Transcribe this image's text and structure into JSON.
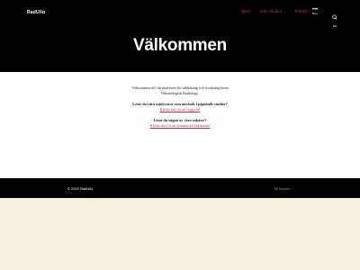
{
  "header": {
    "logo_text": "RadUllo",
    "nav": {
      "items": [
        {
          "label": "Hjem"
        },
        {
          "label": "Arkiv studier"
        },
        {
          "label": "Enkäter"
        }
      ]
    },
    "menu_toggle": {
      "icon": "dots-icon",
      "label": "Meny"
    },
    "search_toggle": {
      "icon": "search-icon",
      "label": "Sök"
    }
  },
  "hero": {
    "title": "Välkommen"
  },
  "main": {
    "intro": "Välkommen till vår plattform för utbildning och forskning inom Odontologisk Radiologi.",
    "question1": "Letar du våra mjukvaror som används i pågående studier?",
    "link1": "Klicka här för att logga in!",
    "question2": "Letar du någon av våra enkäter?",
    "link2": "Klicka här för att komma till enkäterna!"
  },
  "footer": {
    "copyright": "© 2022 RadUllo",
    "to_top": "Till toppen ↑"
  },
  "colors": {
    "accent": "#cd2653",
    "header_bg": "#000000",
    "page_bg": "#f5efe0"
  }
}
